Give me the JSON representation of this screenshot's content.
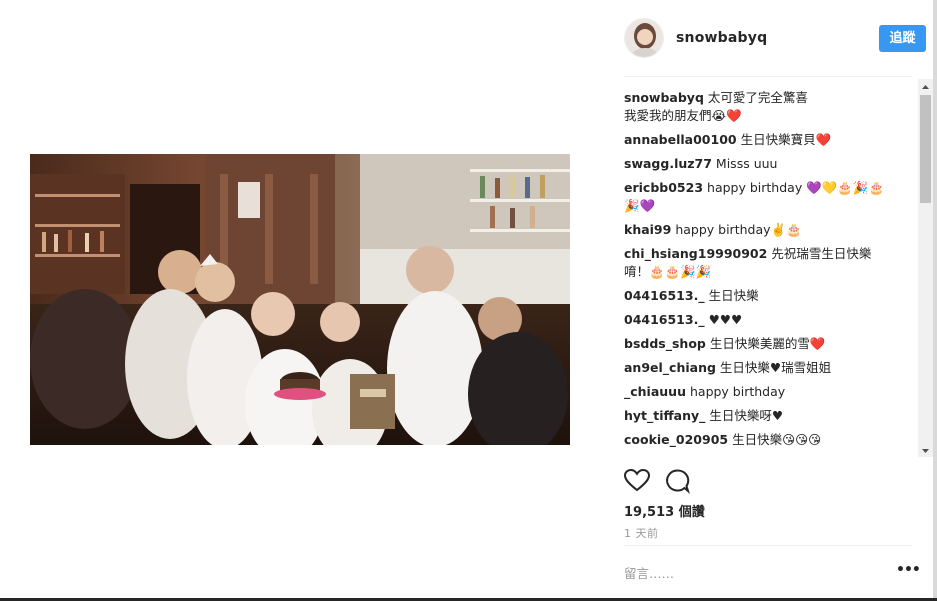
{
  "post": {
    "username": "snowbabyq",
    "follow_label": "追蹤",
    "likes_label": "19,513 個讚",
    "time_label": "1 天前",
    "comment_placeholder": "留言……",
    "more_label": "•••"
  },
  "comments": [
    {
      "user": "snowbabyq",
      "text": "太可愛了完全驚喜\n我愛我的朋友們😭❤️"
    },
    {
      "user": "annabella00100",
      "text": "生日快樂寶貝❤️"
    },
    {
      "user": "swagg.luz77",
      "text": "Misss uuu"
    },
    {
      "user": "ericbb0523",
      "text": "happy birthday 💜💛🎂🎉🎂\n🎉💜"
    },
    {
      "user": "khai99",
      "text": "happy birthday✌️🎂"
    },
    {
      "user": "chi_hsiang19990902",
      "text": "先祝瑞雪生日快樂\n唷！🎂🎂🎉🎉"
    },
    {
      "user": "04416513._",
      "text": "生日快樂"
    },
    {
      "user": "04416513._",
      "text": "♥♥♥"
    },
    {
      "user": "bsdds_shop",
      "text": "生日快樂美麗的雪❤️"
    },
    {
      "user": "an9el_chiang",
      "text": "生日快樂♥瑞雪姐姐"
    },
    {
      "user": "_chiauuu",
      "text": "happy birthday"
    },
    {
      "user": "hyt_tiffany_",
      "text": "生日快樂呀♥"
    },
    {
      "user": "cookie_020905",
      "text": "生日快樂😘😘😘"
    }
  ],
  "icons": {
    "heart": "heart-icon",
    "comment": "comment-bubble-icon",
    "more": "more-options-icon"
  },
  "colors": {
    "accent": "#3897f0",
    "text": "#262626",
    "muted": "#999999",
    "divider": "#efefef"
  }
}
